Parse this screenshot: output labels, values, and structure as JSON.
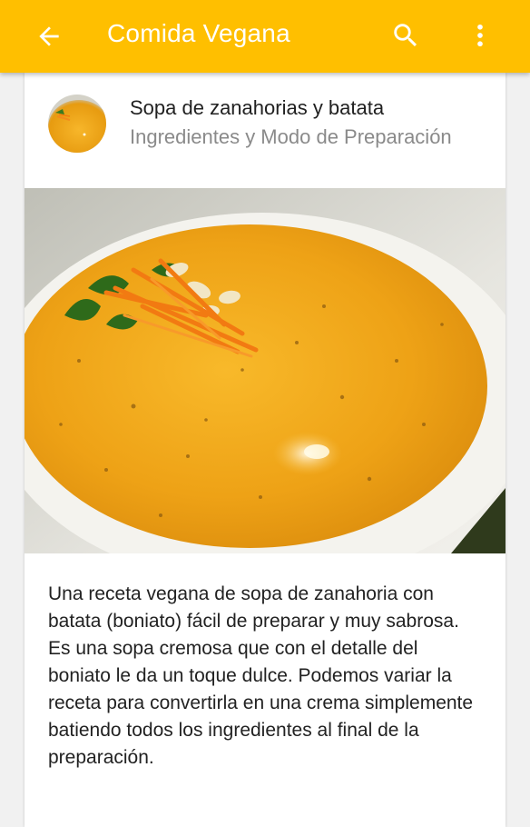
{
  "appbar": {
    "title": "Comida Vegana",
    "background_color": "#FFBF00",
    "icons": [
      "arrow-back-icon",
      "search-icon",
      "more-vert-icon"
    ]
  },
  "recipe": {
    "title": "Sopa de zanahorias y batata",
    "subtitle": "Ingredientes y Modo de Preparación",
    "description": "Una receta vegana de sopa de zanahoria con batata (boniato) fácil de preparar y muy sabrosa. Es una sopa cremosa que con el detalle del boniato le da un toque dulce. Podemos variar la receta para convertirla en una crema simplemente batiendo todos los ingredientes al final de la preparación."
  }
}
